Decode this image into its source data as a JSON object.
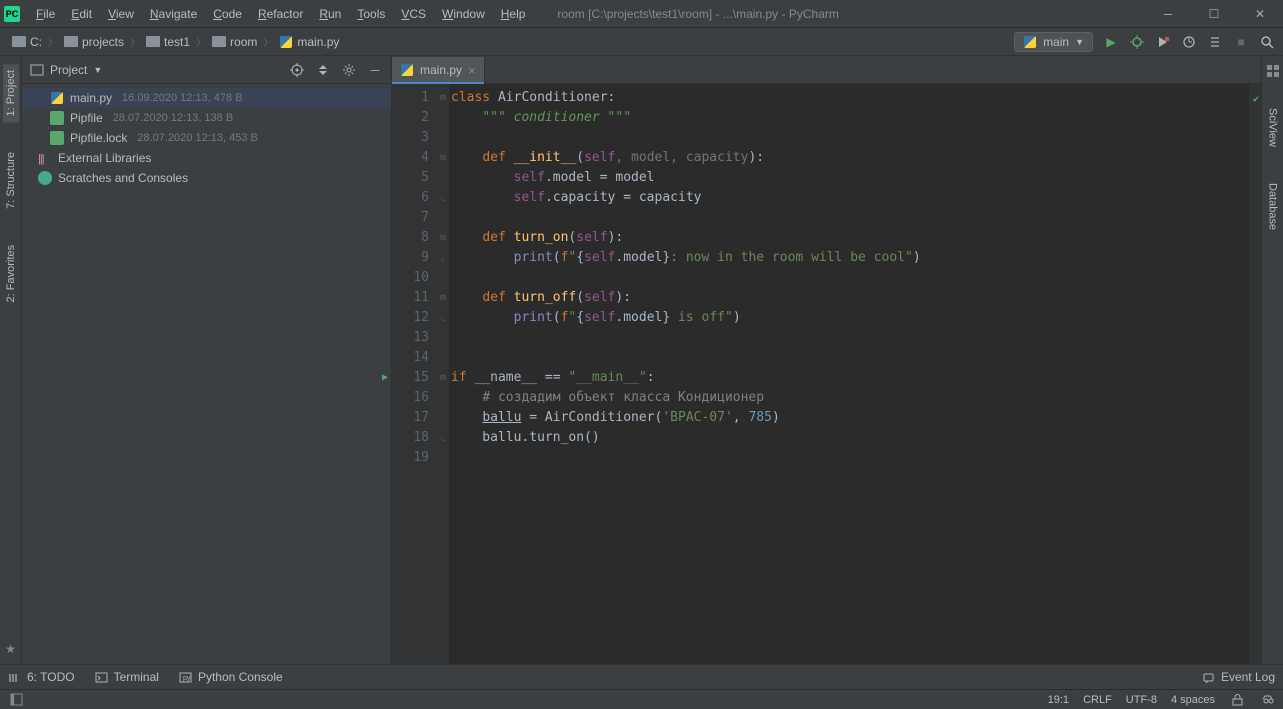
{
  "title": "room [C:\\projects\\test1\\room] - ...\\main.py - PyCharm",
  "menu": [
    "File",
    "Edit",
    "View",
    "Navigate",
    "Code",
    "Refactor",
    "Run",
    "Tools",
    "VCS",
    "Window",
    "Help"
  ],
  "breadcrumbs": [
    {
      "label": "C:"
    },
    {
      "label": "projects"
    },
    {
      "label": "test1"
    },
    {
      "label": "room"
    },
    {
      "label": "main.py",
      "icon": "py"
    }
  ],
  "run_config": {
    "label": "main"
  },
  "project_panel": {
    "title": "Project",
    "items": [
      {
        "name": "main.py",
        "meta": "16.09.2020 12:13, 478 B",
        "icon": "py",
        "selected": true
      },
      {
        "name": "Pipfile",
        "meta": "28.07.2020 12:13, 138 B",
        "icon": "file"
      },
      {
        "name": "Pipfile.lock",
        "meta": "28.07.2020 12:13, 453 B",
        "icon": "file"
      },
      {
        "name": "External Libraries",
        "icon": "lib"
      },
      {
        "name": "Scratches and Consoles",
        "icon": "scratch"
      }
    ]
  },
  "left_tabs": [
    {
      "label": "1: Project",
      "active": true
    },
    {
      "label": "7: Structure"
    },
    {
      "label": "2: Favorites"
    }
  ],
  "right_tabs": [
    {
      "label": "SciView"
    },
    {
      "label": "Database"
    }
  ],
  "editor_tab": "main.py",
  "code_lines": [
    {
      "n": 1,
      "fold": "open",
      "html": "<span class='kw'>class </span>AirConditioner:"
    },
    {
      "n": 2,
      "html": "    <span class='doc'>\"\"\" conditioner \"\"\"</span>"
    },
    {
      "n": 3,
      "html": ""
    },
    {
      "n": 4,
      "fold": "open",
      "html": "    <span class='kw'>def </span><span class='fn'>__init__</span>(<span class='self-kw'>self</span><span class='param'>, model, capacity</span>):"
    },
    {
      "n": 5,
      "html": "        <span class='self-kw'>self</span>.model = model"
    },
    {
      "n": 6,
      "fold": "close",
      "html": "        <span class='self-kw'>self</span>.capacity = capacity"
    },
    {
      "n": 7,
      "html": ""
    },
    {
      "n": 8,
      "fold": "open",
      "html": "    <span class='kw'>def </span><span class='fn'>turn_on</span>(<span class='self-kw'>self</span>):"
    },
    {
      "n": 9,
      "fold": "close",
      "html": "        <span class='builtin'>print</span>(<span class='kw'>f</span><span class='str'>\"</span>{<span class='self-kw'>self</span>.model}<span class='str'>: now in the room will be cool\"</span>)"
    },
    {
      "n": 10,
      "html": ""
    },
    {
      "n": 11,
      "fold": "open",
      "html": "    <span class='kw'>def </span><span class='fn'>turn_off</span>(<span class='self-kw'>self</span>):"
    },
    {
      "n": 12,
      "fold": "close",
      "html": "        <span class='builtin'>print</span>(<span class='kw'>f</span><span class='str'>\"</span>{<span class='self-kw'>self</span>.model}<span class='str'> is off\"</span>)"
    },
    {
      "n": 13,
      "html": ""
    },
    {
      "n": 14,
      "html": ""
    },
    {
      "n": 15,
      "run": true,
      "fold": "open",
      "html": "<span class='kw'>if </span>__name__ == <span class='str'>\"__main__\"</span>:"
    },
    {
      "n": 16,
      "html": "    <span class='comment'># создадим объект класса Кондиционер</span>"
    },
    {
      "n": 17,
      "html": "    <span style='text-decoration:underline'>ballu</span> = AirConditioner(<span class='str'>'BPAC-07'</span>, <span class='num'>785</span>)"
    },
    {
      "n": 18,
      "fold": "close",
      "html": "    ballu.turn_on()"
    },
    {
      "n": 19,
      "html": "    "
    }
  ],
  "bottom": [
    {
      "label": "6: TODO",
      "icon": "todo"
    },
    {
      "label": "Terminal",
      "icon": "terminal"
    },
    {
      "label": "Python Console",
      "icon": "pyconsole"
    }
  ],
  "status": {
    "event_log": "Event Log",
    "pos": "19:1",
    "le": "CRLF",
    "enc": "UTF-8",
    "indent": "4 spaces"
  }
}
